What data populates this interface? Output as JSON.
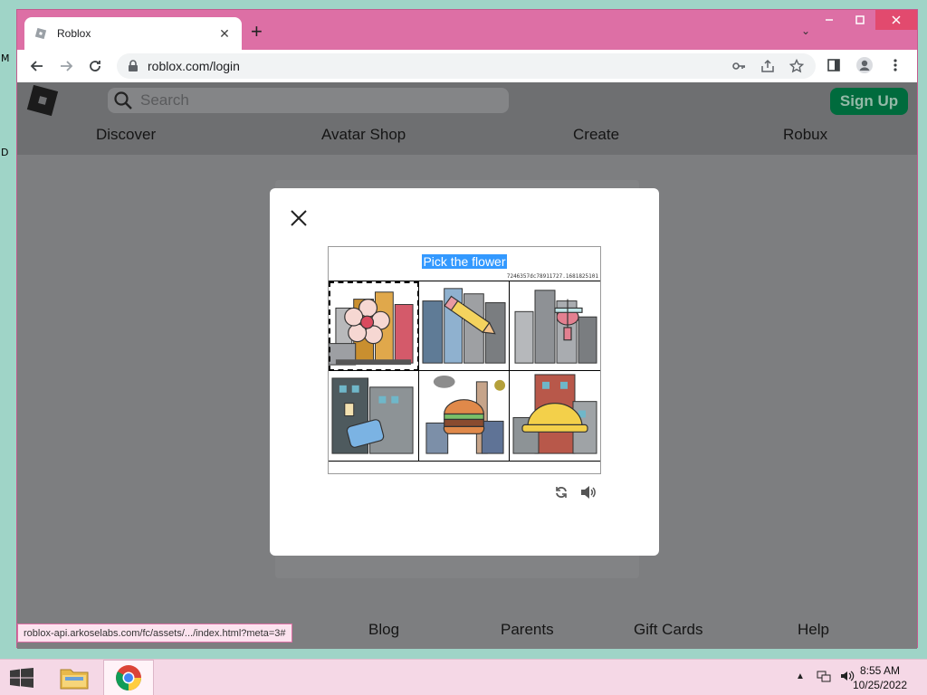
{
  "desktop": {
    "letters": [
      "M",
      "D"
    ]
  },
  "browser": {
    "tab": {
      "title": "Roblox",
      "favicon": "roblox-favicon"
    },
    "new_tab_symbol": "+",
    "url": "roblox.com/login",
    "window_controls": [
      "minimize",
      "maximize",
      "close"
    ]
  },
  "roblox": {
    "search_placeholder": "Search",
    "signup_label": "Sign Up",
    "nav": [
      "Discover",
      "Avatar Shop",
      "Create",
      "Robux"
    ],
    "footer": [
      "Blog",
      "Parents",
      "Gift Cards",
      "Help"
    ]
  },
  "captcha": {
    "prompt": "Pick the flower",
    "challenge_id": "7246357dc78911727.1681825101",
    "tiles": [
      {
        "name": "flower-buildings",
        "object": "flower",
        "selected": true
      },
      {
        "name": "pencil-buildings",
        "object": "pencil",
        "selected": false
      },
      {
        "name": "airplane-buildings",
        "object": "airplane",
        "selected": false
      },
      {
        "name": "toaster-buildings",
        "object": "toaster",
        "selected": false
      },
      {
        "name": "burger-buildings",
        "object": "burger",
        "selected": false
      },
      {
        "name": "hardhat-buildings",
        "object": "hard hat",
        "selected": false
      }
    ],
    "controls": [
      "refresh-icon",
      "audio-icon"
    ]
  },
  "status_url": "roblox-api.arkoselabs.com/fc/assets/.../index.html?meta=3#",
  "taskbar": {
    "apps": [
      "file-explorer",
      "chrome"
    ],
    "time": "8:55 AM",
    "date": "10/25/2022"
  },
  "colors": {
    "window_frame": "#dd6fa5",
    "page_overlay": "#7d7e80",
    "signup": "#006b3d",
    "selection": "#3399ff"
  }
}
